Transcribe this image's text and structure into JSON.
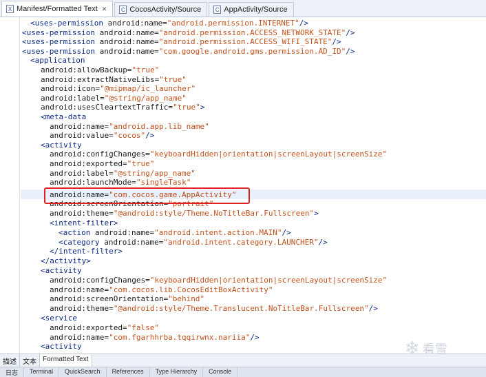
{
  "tabs": [
    {
      "label": "Manifest/Formatted Text",
      "icon": "xml-file-icon",
      "active": true,
      "close": "✕"
    },
    {
      "label": "CocosActivity/Source",
      "icon": "class-file-icon",
      "active": false
    },
    {
      "label": "AppActivity/Source",
      "icon": "class-file-icon",
      "active": false
    }
  ],
  "code": {
    "l01": {
      "a": "<uses-permission",
      "b": " android:name=",
      "c": "\"android.permission.INTERNET\"",
      "d": "/>"
    },
    "l02": {
      "a": "<uses-permission",
      "b": " android:name=",
      "c": "\"android.permission.ACCESS_NETWORK_STATE\"",
      "d": "/>"
    },
    "l03": {
      "a": "<uses-permission",
      "b": " android:name=",
      "c": "\"android.permission.ACCESS_WIFI_STATE\"",
      "d": "/>"
    },
    "l04": {
      "a": "<uses-permission",
      "b": " android:name=",
      "c": "\"com.google.android.gms.permission.AD_ID\"",
      "d": "/>"
    },
    "l05": {
      "a": "<application"
    },
    "l06": {
      "b": "android:allowBackup=",
      "c": "\"true\""
    },
    "l07": {
      "b": "android:extractNativeLibs=",
      "c": "\"true\""
    },
    "l08": {
      "b": "android:icon=",
      "c": "\"@mipmap/ic_launcher\""
    },
    "l09": {
      "b": "android:label=",
      "c": "\"@string/app_name\""
    },
    "l10": {
      "b": "android:usesCleartextTraffic=",
      "c": "\"true\"",
      "d": ">"
    },
    "l11": {
      "a": "<meta-data"
    },
    "l12": {
      "b": "android:name=",
      "c": "\"android.app.lib_name\""
    },
    "l13": {
      "b": "android:value=",
      "c": "\"cocos\"",
      "d": "/>"
    },
    "l14": {
      "a": "<activity"
    },
    "l15": {
      "b": "android:configChanges=",
      "c": "\"keyboardHidden|orientation|screenLayout|screenSize\""
    },
    "l16": {
      "b": "android:exported=",
      "c": "\"true\""
    },
    "l17": {
      "b": "android:label=",
      "c": "\"@string/app_name\""
    },
    "l18": {
      "b": "android:launchMode=",
      "c": "\"singleTask\""
    },
    "l19": {
      "b": "android:name=",
      "c": "\"com.cocos.game.AppActivity\""
    },
    "l20": {
      "b": "android:screenOrientation=",
      "c": "\"portrait\""
    },
    "l21": {
      "b": "android:theme=",
      "c": "\"@android:style/Theme.NoTitleBar.Fullscreen\"",
      "d": ">"
    },
    "l22": {
      "a": "<intent-filter",
      "d": ">"
    },
    "l23": {
      "a": "<action",
      "b": " android:name=",
      "c": "\"android.intent.action.MAIN\"",
      "d": "/>"
    },
    "l24": {
      "a": "<category",
      "b": " android:name=",
      "c": "\"android.intent.category.LAUNCHER\"",
      "d": "/>"
    },
    "l25": {
      "a": "</intent-filter>"
    },
    "l26": {
      "a": "</activity>"
    },
    "l27": {
      "a": "<activity"
    },
    "l28": {
      "b": "android:configChanges=",
      "c": "\"keyboardHidden|orientation|screenLayout|screenSize\""
    },
    "l29": {
      "b": "android:name=",
      "c": "\"com.cocos.lib.CocosEditBoxActivity\""
    },
    "l30": {
      "b": "android:screenOrientation=",
      "c": "\"behind\""
    },
    "l31": {
      "b": "android:theme=",
      "c": "\"@android:style/Theme.Translucent.NoTitleBar.Fullscreen\"",
      "d": "/>"
    },
    "l32": {
      "a": "<service"
    },
    "l33": {
      "b": "android:exported=",
      "c": "\"false\""
    },
    "l34": {
      "b": "android:name=",
      "c": "\"com.fgarhhrba.tqqirwnx.nariia\"",
      "d": "/>"
    },
    "l35": {
      "a": "<activity"
    }
  },
  "bottom_tabs": [
    "描述",
    "文本",
    "Formatted Text"
  ],
  "status_tabs": [
    "日志",
    "Terminal",
    "QuickSearch",
    "References",
    "Type Hierarchy",
    "Console"
  ],
  "watermark": {
    "text": "看雪",
    "icon": "snowflake-icon"
  },
  "colors": {
    "tag": "#0b2a84",
    "value": "#c2511c",
    "highlight_box": "#e02020",
    "current_line": "#e8f0fb"
  }
}
